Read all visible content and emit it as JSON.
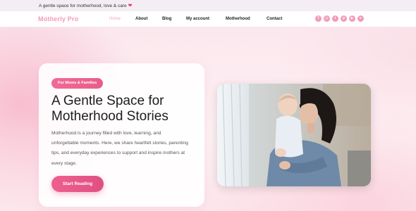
{
  "topbar": {
    "tagline": "A gentle space for motherhood, love & care",
    "heart": "❤"
  },
  "navbar": {
    "logo": "Motherly Pro",
    "links": [
      "Home",
      "About",
      "Blog",
      "My account",
      "Motherhood",
      "Contact"
    ],
    "active_index": 0,
    "socials": [
      {
        "icon": "facebook-icon",
        "glyph": "f"
      },
      {
        "icon": "instagram-icon",
        "glyph": "◎"
      },
      {
        "icon": "twitter-icon",
        "glyph": "t"
      },
      {
        "icon": "pinterest-icon",
        "glyph": "p"
      },
      {
        "icon": "youtube-icon",
        "glyph": "▶"
      },
      {
        "icon": "telegram-icon",
        "glyph": "➤"
      }
    ]
  },
  "hero": {
    "badge": "For Moms & Families",
    "title": "A Gentle Space for Motherhood Stories",
    "description": "Motherhood is a journey filled with love, learning, and unforgettable moments. Here, we share heartfelt stories, parenting tips, and everyday experiences to support and inspire mothers at every stage.",
    "cta_label": "Start Reading"
  },
  "colors": {
    "accent": "#e85d8a",
    "logo": "#f29bb8",
    "active_link": "#f3a7bf"
  }
}
